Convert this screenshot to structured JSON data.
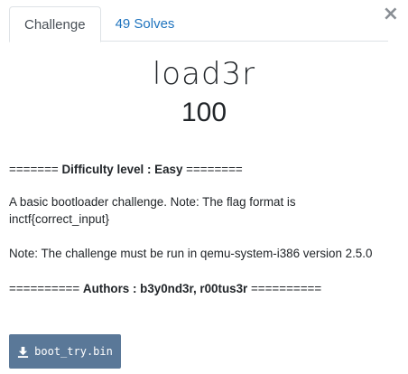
{
  "modal": {
    "close_label": "×",
    "tabs": [
      {
        "label": "Challenge",
        "active": true
      },
      {
        "label": "49 Solves",
        "active": false
      }
    ]
  },
  "challenge": {
    "name": "load3r",
    "value": "100",
    "difficulty_prefix": "======= ",
    "difficulty_text": "Difficulty level : Easy",
    "difficulty_suffix": " ========",
    "description": "A basic bootloader challenge. Note: The flag format is inctf{correct_input}",
    "note": "Note: The challenge must be run in qemu-system-i386 version 2.5.0",
    "authors_prefix": "========== ",
    "authors_text": "Authors : b3y0nd3r, r00tus3r",
    "authors_suffix": " ==========",
    "file": {
      "name": "boot_try.bin",
      "icon": "download-icon"
    }
  },
  "colors": {
    "link": "#1e73be",
    "button": "#5a7898",
    "text": "#212529"
  }
}
